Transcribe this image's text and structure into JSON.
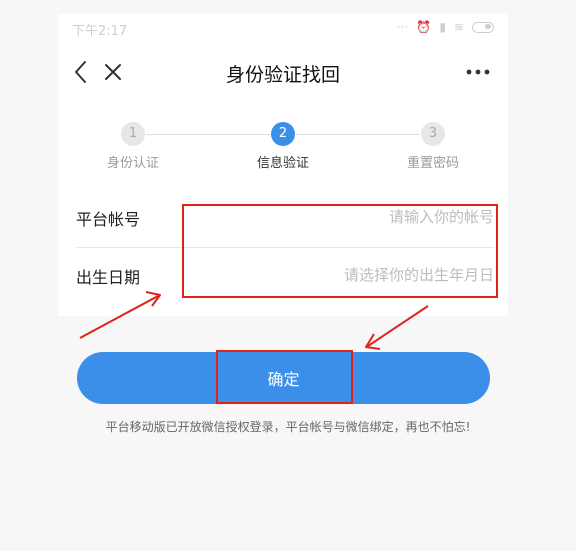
{
  "status_bar": {
    "time": "下午2:17",
    "icons": [
      "dots-icon",
      "alarm-icon",
      "signal-icon",
      "wifi-icon",
      "battery-icon"
    ]
  },
  "header": {
    "title": "身份验证找回",
    "back_icon": "chevron-left-icon",
    "close_icon": "close-icon",
    "more_icon": "more-horizontal-icon"
  },
  "stepper": {
    "steps": [
      {
        "number": "1",
        "label": "身份认证"
      },
      {
        "number": "2",
        "label": "信息验证"
      },
      {
        "number": "3",
        "label": "重置密码"
      }
    ],
    "active_step": "2"
  },
  "form": {
    "account": {
      "label": "平台帐号",
      "placeholder": "请输入你的帐号"
    },
    "birthdate": {
      "label": "出生日期",
      "placeholder": "请选择你的出生年月日"
    }
  },
  "confirm_button": {
    "label": "确定"
  },
  "footer": {
    "note": "平台移动版已开放微信授权登录，平台帐号与微信绑定，再也不怕忘!"
  },
  "colors": {
    "accent": "#3b8fe8",
    "annotation": "#e0231a",
    "page_bg": "#f7f7f7",
    "panel_bg": "#ffffff"
  }
}
